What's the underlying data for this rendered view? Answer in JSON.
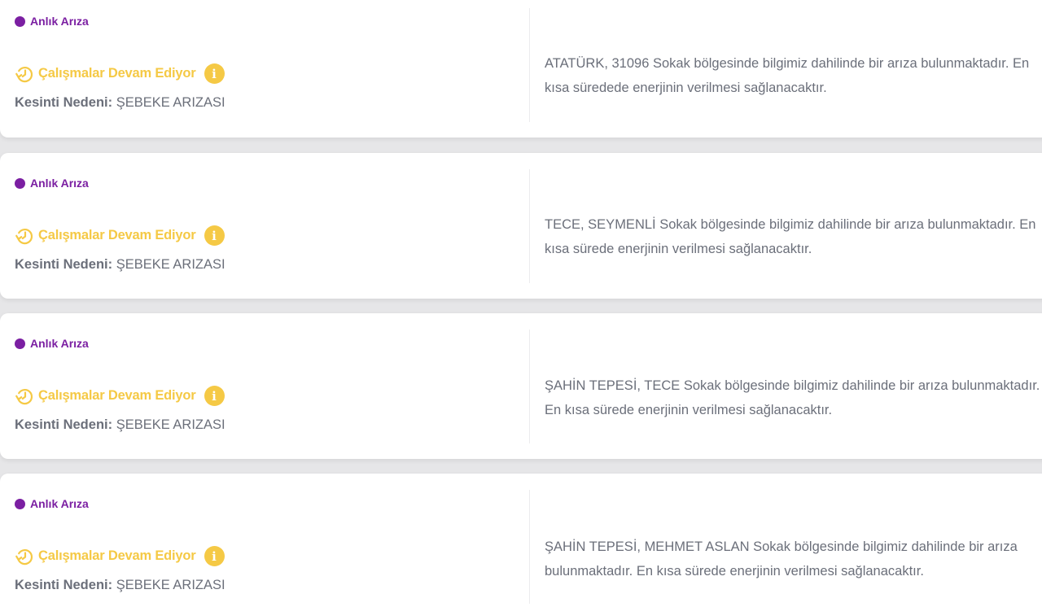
{
  "colors": {
    "type_accent": "#7b1fa2",
    "status_accent": "#f5c945",
    "text": "#6b6f7a",
    "background": "#e6e6e8"
  },
  "outages": [
    {
      "type_label": "Anlık Arıza",
      "status_label": "Çalışmalar Devam Ediyor",
      "status_icon": "clock-rotate-icon",
      "info_icon": "info-icon",
      "reason_key": "Kesinti Nedeni:",
      "reason_value": "ŞEBEKE ARIZASI",
      "description": "ATATÜRK, 31096 Sokak bölgesinde bilgimiz dahilinde bir arıza bulunmaktadır. En kısa süredede enerjinin verilmesi sağlanacaktır."
    },
    {
      "type_label": "Anlık Arıza",
      "status_label": "Çalışmalar Devam Ediyor",
      "status_icon": "clock-rotate-icon",
      "info_icon": "info-icon",
      "reason_key": "Kesinti Nedeni:",
      "reason_value": "ŞEBEKE ARIZASI",
      "description": "TECE, SEYMENLİ Sokak bölgesinde bilgimiz dahilinde bir arıza bulunmaktadır. En kısa sürede enerjinin verilmesi sağlanacaktır."
    },
    {
      "type_label": "Anlık Arıza",
      "status_label": "Çalışmalar Devam Ediyor",
      "status_icon": "clock-rotate-icon",
      "info_icon": "info-icon",
      "reason_key": "Kesinti Nedeni:",
      "reason_value": "ŞEBEKE ARIZASI",
      "description": "ŞAHİN TEPESİ, TECE Sokak bölgesinde bilgimiz dahilinde bir arıza bulunmaktadır. En kısa sürede enerjinin verilmesi sağlanacaktır."
    },
    {
      "type_label": "Anlık Arıza",
      "status_label": "Çalışmalar Devam Ediyor",
      "status_icon": "clock-rotate-icon",
      "info_icon": "info-icon",
      "reason_key": "Kesinti Nedeni:",
      "reason_value": "ŞEBEKE ARIZASI",
      "description": "ŞAHİN TEPESİ, MEHMET ASLAN Sokak bölgesinde bilgimiz dahilinde bir arıza bulunmaktadır. En kısa sürede enerjinin verilmesi sağlanacaktır."
    }
  ]
}
